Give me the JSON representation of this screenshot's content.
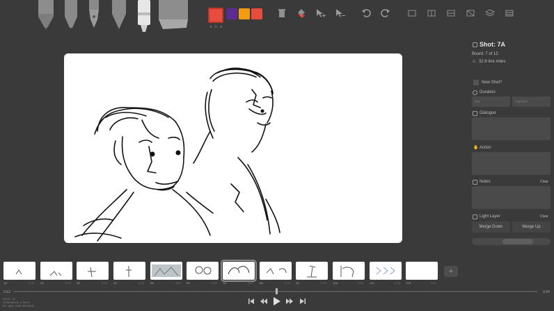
{
  "toolbar": {
    "tools": [
      "light-pencil-icon",
      "pencil-icon",
      "pen-icon",
      "brush-icon",
      "marker-icon",
      "eraser-icon"
    ],
    "colors": {
      "main": "#e74c3c",
      "swatch1": "#5b2d91",
      "swatch2": "#f39c12",
      "swatch3": "#e74c3c"
    },
    "swatch_dots": "◂ ◎ ▸",
    "action_icons": [
      "trash-icon",
      "fill-icon",
      "add-selection-icon",
      "remove-selection-icon",
      "undo-icon",
      "redo-icon",
      "layout-1-icon",
      "layout-2-icon",
      "layout-3-icon",
      "layout-4-icon",
      "layers-icon",
      "grid-icon"
    ]
  },
  "panel": {
    "shot_title": "Shot: 7A",
    "board_info": "Board: 7 of 12",
    "line_miles": "32.9 line miles",
    "new_shot_label": "New Shot?",
    "duration_label": "Duration",
    "ms_placeholder": "ms",
    "frames_placeholder": "frames",
    "dialogue_label": "Dialogue",
    "action_label": "Action",
    "notes_label": "Notes",
    "notes_clear": "Clear",
    "light_layer_label": "Light Layer",
    "light_layer_clear": "Clear",
    "merge_down": "Merge Down",
    "merge_up": "Merge Up"
  },
  "filmstrip": {
    "boards": [
      {
        "label": "1A",
        "dur": "0:02"
      },
      {
        "label": "2A",
        "dur": "0:02"
      },
      {
        "label": "3A",
        "dur": "0:02"
      },
      {
        "label": "4A",
        "dur": "0:02"
      },
      {
        "label": "5A",
        "dur": "0:02"
      },
      {
        "label": "6A",
        "dur": "0:02"
      },
      {
        "label": "7A",
        "dur": "0:02"
      },
      {
        "label": "8A",
        "dur": "0:02"
      },
      {
        "label": "9A",
        "dur": "0:02"
      },
      {
        "label": "10A",
        "dur": "0:02"
      },
      {
        "label": "11A",
        "dur": "0:02"
      },
      {
        "label": "12A",
        "dur": "0:02"
      }
    ],
    "add_label": "+"
  },
  "timeline": {
    "start_time": "0:12",
    "end_time": "0:24",
    "meta_line1": "SHOT: 7A",
    "meta_line2": "12 BOARDS, 1 SHOT",
    "meta_line3": "BY: BEN, LINE MILEAGE",
    "controls": [
      "skip-start-icon",
      "rewind-icon",
      "play-icon",
      "fast-forward-icon",
      "skip-end-icon"
    ]
  }
}
